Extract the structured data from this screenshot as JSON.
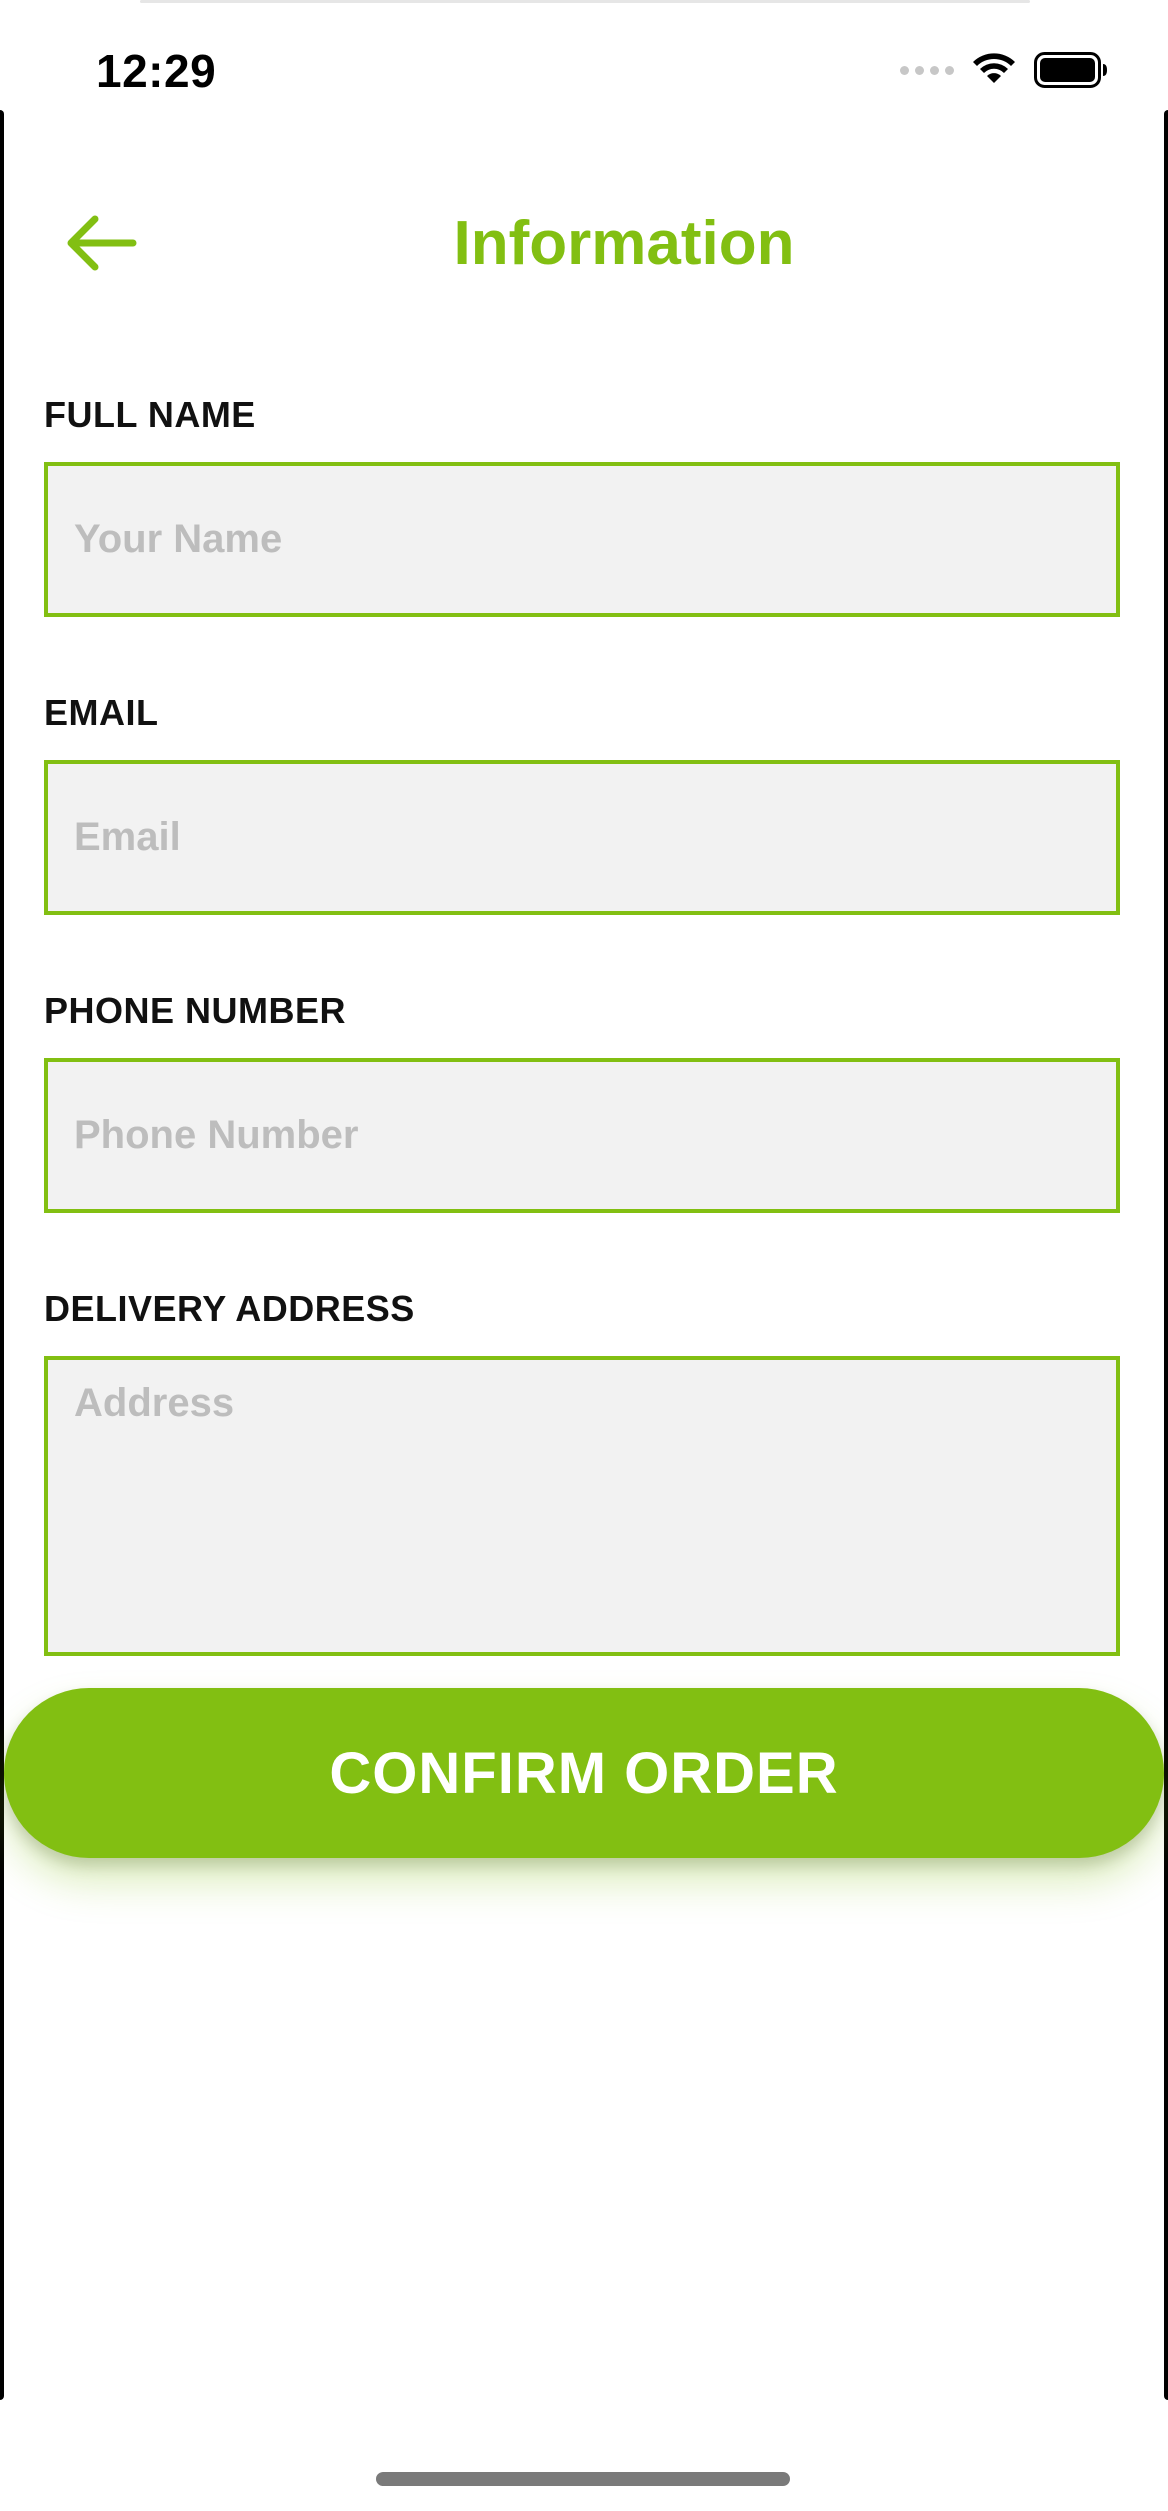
{
  "status_bar": {
    "time": "12:29",
    "icons": [
      "signal-icon",
      "wifi-icon",
      "battery-icon"
    ]
  },
  "header": {
    "back_icon": "arrow-left-icon",
    "title": "Information"
  },
  "form": {
    "full_name": {
      "label": "FULL NAME",
      "placeholder": "Your Name",
      "value": ""
    },
    "email": {
      "label": "EMAIL",
      "placeholder": "Email",
      "value": ""
    },
    "phone": {
      "label": "PHONE NUMBER",
      "placeholder": "Phone Number",
      "value": ""
    },
    "address": {
      "label": "DELIVERY ADDRESS",
      "placeholder": "Address",
      "value": ""
    }
  },
  "actions": {
    "confirm_label": "CONFIRM ORDER"
  },
  "colors": {
    "accent": "#82BF12",
    "input_background": "#F2F2F2",
    "placeholder": "#BDBDBD",
    "label": "#111111"
  }
}
